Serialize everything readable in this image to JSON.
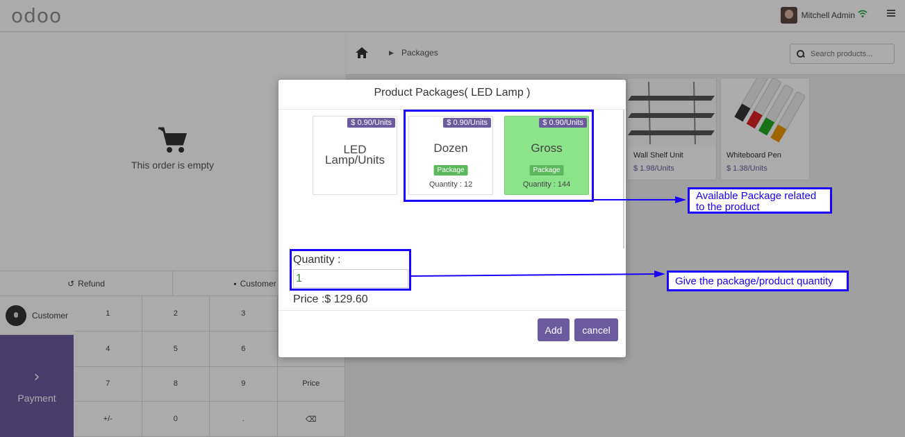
{
  "topbar": {
    "logo": "odoo",
    "user_name": "Mitchell Admin"
  },
  "left": {
    "empty_text": "This order is empty",
    "refund_label": "Refund",
    "customer_note_label": "Customer N",
    "customer_label": "Customer",
    "payment_label": "Payment",
    "numpad": [
      "1",
      "2",
      "3",
      "",
      "4",
      "5",
      "6",
      "",
      "7",
      "8",
      "9",
      "Price",
      "+/-",
      "0",
      ".",
      "⌫"
    ]
  },
  "right": {
    "breadcrumb": "Packages",
    "search_placeholder": "Search products...",
    "products": [
      {
        "name": "Wall Shelf Unit",
        "price": "$ 1.98/Units"
      },
      {
        "name": "Whiteboard Pen",
        "price": "$ 1.38/Units"
      }
    ]
  },
  "modal": {
    "title": "Product Packages( LED Lamp )",
    "packages": [
      {
        "price": "$ 0.90/Units",
        "name_line1": "LED",
        "name_line2": "Lamp/Units",
        "badge": "",
        "quantity": ""
      },
      {
        "price": "$ 0.90/Units",
        "name_line1": "Dozen",
        "name_line2": "",
        "badge": "Package",
        "quantity": "Quantity : 12"
      },
      {
        "price": "$ 0.90/Units",
        "name_line1": "Gross",
        "name_line2": "",
        "badge": "Package",
        "quantity": "Quantity : 144"
      }
    ],
    "quantity_label": "Quantity :",
    "quantity_value": "1",
    "price_text": "Price :$ 129.60",
    "add_label": "Add",
    "cancel_label": "cancel"
  },
  "annotations": {
    "packages_note": "Available Package related to the product",
    "quantity_note": "Give the package/product quantity"
  },
  "colors": {
    "accent": "#6c5a9e",
    "selected": "#8be38a",
    "annotation": "#1a00ff"
  }
}
